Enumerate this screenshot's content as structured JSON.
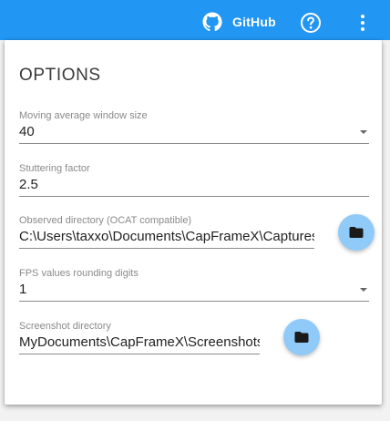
{
  "topbar": {
    "github_label": "GitHub",
    "github_icon": "github-icon",
    "help_icon": "help-circle-icon",
    "menu_icon": "dots-vertical-icon",
    "color": "#2196f3"
  },
  "options": {
    "title": "OPTIONS",
    "fields": [
      {
        "label": "Moving average window size",
        "value": "40",
        "type": "dropdown"
      },
      {
        "label": "Stuttering factor",
        "value": "2.5",
        "type": "text"
      },
      {
        "label": "Observed directory (OCAT compatible)",
        "value": "C:\\Users\\taxxo\\Documents\\CapFrameX\\Captures",
        "type": "path"
      },
      {
        "label": "FPS values rounding digits",
        "value": "1",
        "type": "dropdown"
      },
      {
        "label": "Screenshot directory",
        "value": "MyDocuments\\CapFrameX\\Screenshots",
        "type": "path"
      }
    ],
    "folder_icon": "folder-icon",
    "fab_color": "#90caf9"
  }
}
